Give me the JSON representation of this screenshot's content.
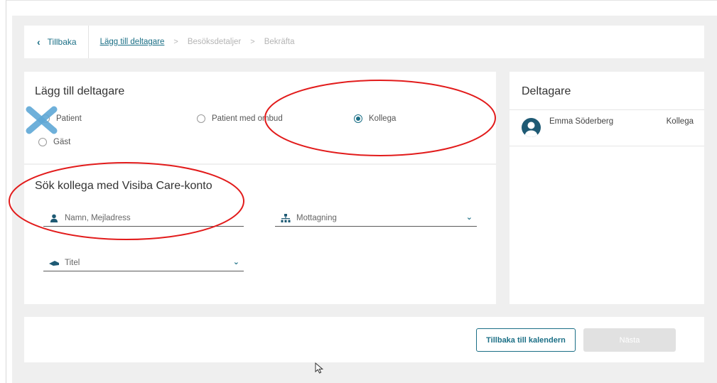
{
  "breadcrumb": {
    "back_label": "Tillbaka",
    "steps": [
      "Lägg till deltagare",
      "Besöksdetaljer",
      "Bekräfta"
    ]
  },
  "add_participant": {
    "title": "Lägg till deltagare",
    "options": [
      "Patient",
      "Patient med ombud",
      "Kollega",
      "Gäst"
    ],
    "selected": "Kollega"
  },
  "search": {
    "title": "Sök kollega med Visiba Care-konto",
    "name_placeholder": "Namn, Mejladress",
    "reception_label": "Mottagning",
    "title_label": "Titel"
  },
  "participants": {
    "title": "Deltagare",
    "items": [
      {
        "name": "Emma Söderberg",
        "role": "Kollega"
      }
    ]
  },
  "footer": {
    "back_to_calendar": "Tillbaka till kalendern",
    "next": "Nästa"
  },
  "colors": {
    "accent": "#1b6f86",
    "annotation_red": "#e21b1b",
    "annotation_x": "#5fa8d6"
  }
}
